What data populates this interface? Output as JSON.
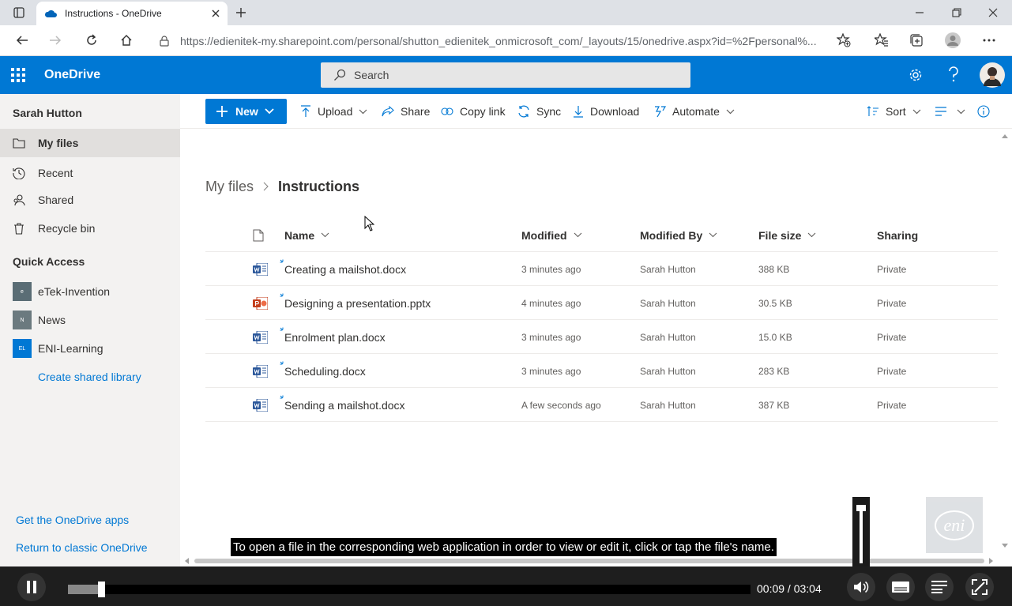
{
  "browser": {
    "tab_title": "Instructions - OneDrive",
    "url": "https://edienitek-my.sharepoint.com/personal/shutton_edienitek_onmicrosoft_com/_layouts/15/onedrive.aspx?id=%2Fpersonal%..."
  },
  "suite": {
    "app_name": "OneDrive",
    "search_placeholder": "Search"
  },
  "sidebar": {
    "user_name": "Sarah Hutton",
    "items": [
      {
        "label": "My files",
        "icon": "folder-icon",
        "selected": true
      },
      {
        "label": "Recent",
        "icon": "clock-icon"
      },
      {
        "label": "Shared",
        "icon": "people-icon"
      },
      {
        "label": "Recycle bin",
        "icon": "trash-icon"
      }
    ],
    "quick_access_title": "Quick Access",
    "libraries": [
      {
        "label": "eTek-Invention",
        "badge": "e",
        "color": "#5a6d75"
      },
      {
        "label": "News",
        "badge": "N",
        "color": "#6b7a7f"
      },
      {
        "label": "ENI-Learning",
        "badge": "EL",
        "color": "#0078d4"
      }
    ],
    "create_library": "Create shared library",
    "get_apps": "Get the OneDrive apps",
    "return_classic": "Return to classic OneDrive"
  },
  "commands": {
    "new": "New",
    "upload": "Upload",
    "share": "Share",
    "copy_link": "Copy link",
    "sync": "Sync",
    "download": "Download",
    "automate": "Automate",
    "sort": "Sort"
  },
  "breadcrumb": {
    "root": "My files",
    "current": "Instructions"
  },
  "table": {
    "headers": {
      "name": "Name",
      "modified": "Modified",
      "modified_by": "Modified By",
      "file_size": "File size",
      "sharing": "Sharing"
    },
    "rows": [
      {
        "name": "Creating a mailshot.docx",
        "type": "word",
        "modified": "3 minutes ago",
        "modified_by": "Sarah Hutton",
        "size": "388 KB",
        "sharing": "Private"
      },
      {
        "name": "Designing a presentation.pptx",
        "type": "powerpoint",
        "modified": "4 minutes ago",
        "modified_by": "Sarah Hutton",
        "size": "30.5 KB",
        "sharing": "Private"
      },
      {
        "name": "Enrolment plan.docx",
        "type": "word",
        "modified": "3 minutes ago",
        "modified_by": "Sarah Hutton",
        "size": "15.0 KB",
        "sharing": "Private"
      },
      {
        "name": "Scheduling.docx",
        "type": "word",
        "modified": "3 minutes ago",
        "modified_by": "Sarah Hutton",
        "size": "283 KB",
        "sharing": "Private"
      },
      {
        "name": "Sending a mailshot.docx",
        "type": "word",
        "modified": "A few seconds ago",
        "modified_by": "Sarah Hutton",
        "size": "387 KB",
        "sharing": "Private"
      }
    ]
  },
  "player": {
    "caption": "To open a file in the corresponding web application in order to view or edit it, click or tap the file's name.",
    "time": "00:09 / 03:04",
    "progress_fraction": 0.049,
    "watermark": "eni"
  },
  "colors": {
    "brand": "#0078d4",
    "word": "#2b579a",
    "powerpoint": "#c43e1c"
  }
}
